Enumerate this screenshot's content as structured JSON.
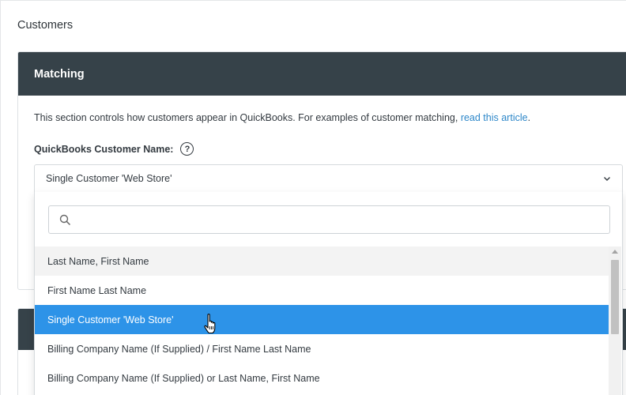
{
  "page": {
    "title": "Customers"
  },
  "matching": {
    "header": "Matching",
    "description_text": "This section controls how customers appear in QuickBooks. For examples of customer matching, ",
    "description_link": "read this article",
    "description_end": ".",
    "field_label": "QuickBooks Customer Name:",
    "help_icon": "question-circle-icon"
  },
  "select": {
    "value": "Single Customer 'Web Store'",
    "chevron_icon": "chevron-down-icon"
  },
  "dropdown": {
    "search_value": "",
    "search_icon": "search-icon",
    "options": [
      {
        "label": "Last Name, First Name",
        "state": "hover"
      },
      {
        "label": "First Name Last Name",
        "state": "normal"
      },
      {
        "label": "Single Customer 'Web Store'",
        "state": "selected"
      },
      {
        "label": "Billing Company Name (If Supplied) / First Name Last Name",
        "state": "normal"
      },
      {
        "label": "Billing Company Name (If Supplied) or Last Name, First Name",
        "state": "normal"
      }
    ]
  },
  "colors": {
    "header_bg": "#364249",
    "selected_bg": "#2d93e8",
    "link": "#2d87c9"
  }
}
